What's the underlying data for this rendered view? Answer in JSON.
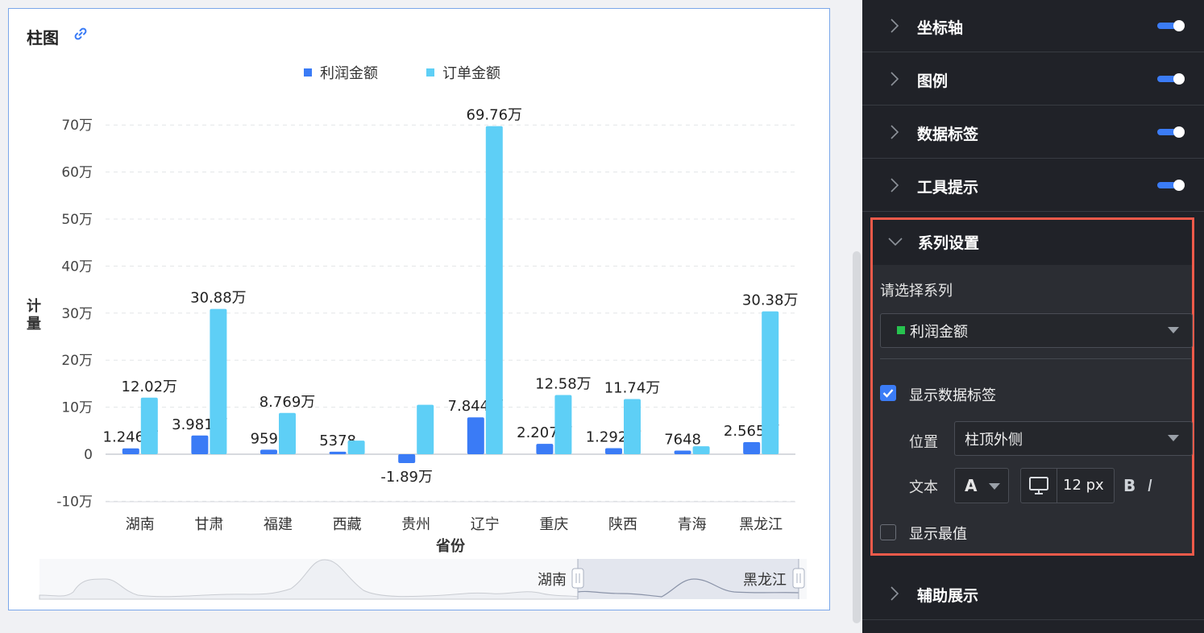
{
  "chart_card": {
    "title": "柱图",
    "link_icon": "link-icon"
  },
  "chart_data": {
    "type": "bar",
    "categories": [
      "湖南",
      "甘肃",
      "福建",
      "西藏",
      "贵州",
      "辽宁",
      "重庆",
      "陕西",
      "青海",
      "黑龙江"
    ],
    "series": [
      {
        "name": "利润金额",
        "color": "#3a7bf6",
        "values": [
          12460,
          39810,
          9599,
          5378,
          -18900,
          78440,
          22070,
          12920,
          7648,
          25650
        ],
        "labels": [
          "1.246万",
          "3.981万",
          "9599",
          "5378",
          "-1.89万",
          "7.844万",
          "2.207万",
          "1.292万",
          "7648",
          "2.565万"
        ]
      },
      {
        "name": "订单金额",
        "color": "#5ecff6",
        "values": [
          120200,
          308800,
          87690,
          29000,
          105000,
          697600,
          125800,
          117400,
          17000,
          303800
        ],
        "labels": [
          "12.02万",
          "30.88万",
          "8.769万",
          "",
          "",
          "69.76万",
          "12.58万",
          "11.74万",
          "",
          "30.38万"
        ]
      }
    ],
    "yticks": [
      "70万",
      "60万",
      "50万",
      "40万",
      "30万",
      "20万",
      "10万",
      "0",
      "-10万"
    ],
    "ylim": [
      -100000,
      700000
    ],
    "xlabel": "省份",
    "ylabel": "计量",
    "grid": "dashed-horizontal",
    "legend_position": "top"
  },
  "slider": {
    "start_label": "湖南",
    "end_label": "黑龙江"
  },
  "panel": {
    "rows": [
      {
        "label": "坐标轴",
        "enabled": true
      },
      {
        "label": "图例",
        "enabled": true
      },
      {
        "label": "数据标签",
        "enabled": true
      },
      {
        "label": "工具提示",
        "enabled": true
      }
    ],
    "series_section": {
      "title": "系列设置",
      "select_label": "请选择系列",
      "selected_series": "利润金额",
      "selected_series_color": "#27c34f",
      "show_data_labels": "显示数据标签",
      "show_data_labels_checked": true,
      "position_label": "位置",
      "position_value": "柱顶外侧",
      "text_label": "文本",
      "font_glyph": "A",
      "font_size": "12 px",
      "bold": "B",
      "italic": "I",
      "show_extreme": "显示最值",
      "show_extreme_checked": false
    },
    "bottom_row": {
      "label": "辅助展示"
    }
  },
  "colors": {
    "accent": "#3b7cf6",
    "highlight_border": "#ef5a4a",
    "panel_bg": "#202228"
  }
}
